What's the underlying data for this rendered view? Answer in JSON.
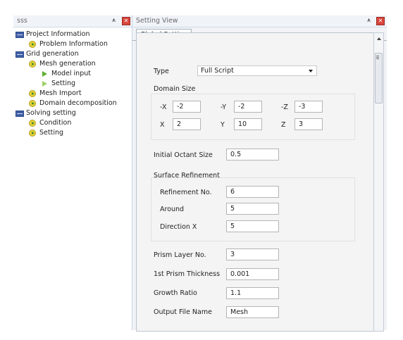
{
  "tree_panel": {
    "title": "sss",
    "pin_icon": "pin-icon",
    "close_icon": "close-icon",
    "nodes": [
      {
        "label": "Project Information",
        "icon": "folder-icon"
      },
      {
        "label": "Problem Information",
        "icon": "play-icon"
      },
      {
        "label": "Grid generation",
        "icon": "folder-icon"
      },
      {
        "label": "Mesh generation",
        "icon": "play-icon"
      },
      {
        "label": "Model input",
        "icon": "arrow-icon"
      },
      {
        "label": "Setting",
        "icon": "arrow-icon"
      },
      {
        "label": "Mesh Import",
        "icon": "play-icon"
      },
      {
        "label": "Domain decomposition",
        "icon": "play-icon"
      },
      {
        "label": "Solving setting",
        "icon": "folder-icon"
      },
      {
        "label": "Condition",
        "icon": "play-icon"
      },
      {
        "label": "Setting",
        "icon": "play-icon"
      }
    ]
  },
  "setting_view": {
    "title": "Setting View",
    "tab": "Global Setting",
    "type": {
      "label": "Type",
      "value": "Full Script"
    },
    "domain_size": {
      "label": "Domain Size",
      "min_x_label": "-X",
      "min_x": "-2",
      "min_y_label": "-Y",
      "min_y": "-2",
      "min_z_label": "-Z",
      "min_z": "-3",
      "max_x_label": "X",
      "max_x": "2",
      "max_y_label": "Y",
      "max_y": "10",
      "max_z_label": "Z",
      "max_z": "3"
    },
    "initial_octant": {
      "label": "Initial Octant Size",
      "value": "0.5"
    },
    "surface_refinement": {
      "label": "Surface Refinement",
      "refinement_no_label": "Refinement No.",
      "refinement_no": "6",
      "around_label": "Around",
      "around": "5",
      "direction_x_label": "Direction X",
      "direction_x": "5"
    },
    "prism_layer": {
      "label": "Prism Layer No.",
      "value": "3"
    },
    "first_prism": {
      "label": "1st Prism Thickness",
      "value": "0.001"
    },
    "growth_ratio": {
      "label": "Growth Ratio",
      "value": "1.1"
    },
    "output_file": {
      "label": "Output File Name",
      "value": "Mesh"
    }
  },
  "colors": {
    "header_bg": "#f0f4f9",
    "close_red": "#d9463c",
    "folder_blue": "#3f5fa6",
    "arrow_green": "#5bb12e"
  }
}
